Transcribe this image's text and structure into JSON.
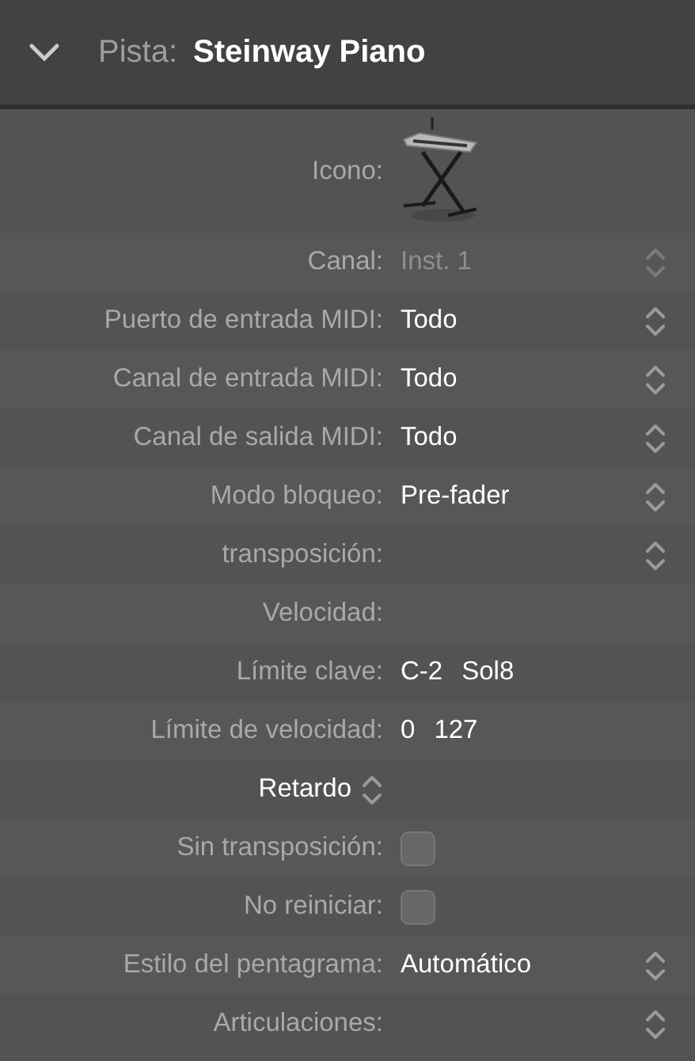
{
  "header": {
    "expanded": true,
    "label": "Pista:",
    "title": "Steinway Piano"
  },
  "rows": [
    {
      "kind": "icon",
      "label": "Icono:"
    },
    {
      "kind": "popup",
      "label": "Canal:",
      "value": "Inst. 1",
      "disabled": true
    },
    {
      "kind": "popup",
      "label": "Puerto de entrada MIDI:",
      "value": "Todo",
      "disabled": false
    },
    {
      "kind": "popup",
      "label": "Canal de entrada MIDI:",
      "value": "Todo",
      "disabled": false
    },
    {
      "kind": "popup",
      "label": "Canal de salida MIDI:",
      "value": "Todo",
      "disabled": false
    },
    {
      "kind": "popup",
      "label": "Modo bloqueo:",
      "value": "Pre-fader",
      "disabled": false
    },
    {
      "kind": "popup",
      "label": "transposición:",
      "disabled": false
    },
    {
      "kind": "label",
      "label": "Velocidad:"
    },
    {
      "kind": "range",
      "label": "Límite clave:",
      "values": [
        "C-2",
        "Sol8"
      ]
    },
    {
      "kind": "range",
      "label": "Límite de velocidad:",
      "values": [
        "0",
        "127"
      ]
    },
    {
      "kind": "menu",
      "label": "Retardo"
    },
    {
      "kind": "checkbox",
      "label": "Sin transposición:",
      "checked": false
    },
    {
      "kind": "checkbox",
      "label": "No reiniciar:",
      "checked": false
    },
    {
      "kind": "popup",
      "label": "Estilo del pentagrama:",
      "value": "Automático",
      "disabled": false
    },
    {
      "kind": "popup",
      "label": "Articulaciones:",
      "disabled": false
    }
  ]
}
